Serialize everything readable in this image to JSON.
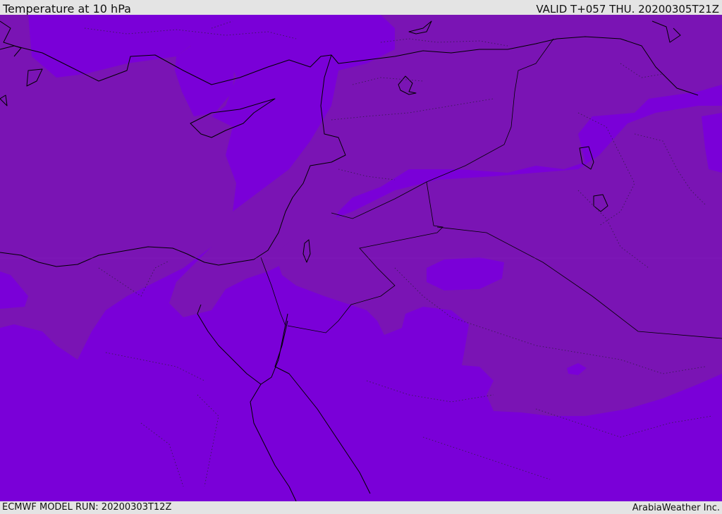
{
  "header": {
    "title": "Temperature at 10 hPa",
    "valid": "VALID T+057 THU. 20200305T21Z"
  },
  "footer": {
    "model_run": "ECMWF MODEL RUN: 20200303T12Z",
    "credit": "ArabiaWeather Inc."
  },
  "colors": {
    "field_dark": "#7a14b4",
    "field_light": "#7a00d8",
    "frame_bg": "#e4e4e4",
    "coastline": "#000000"
  }
}
